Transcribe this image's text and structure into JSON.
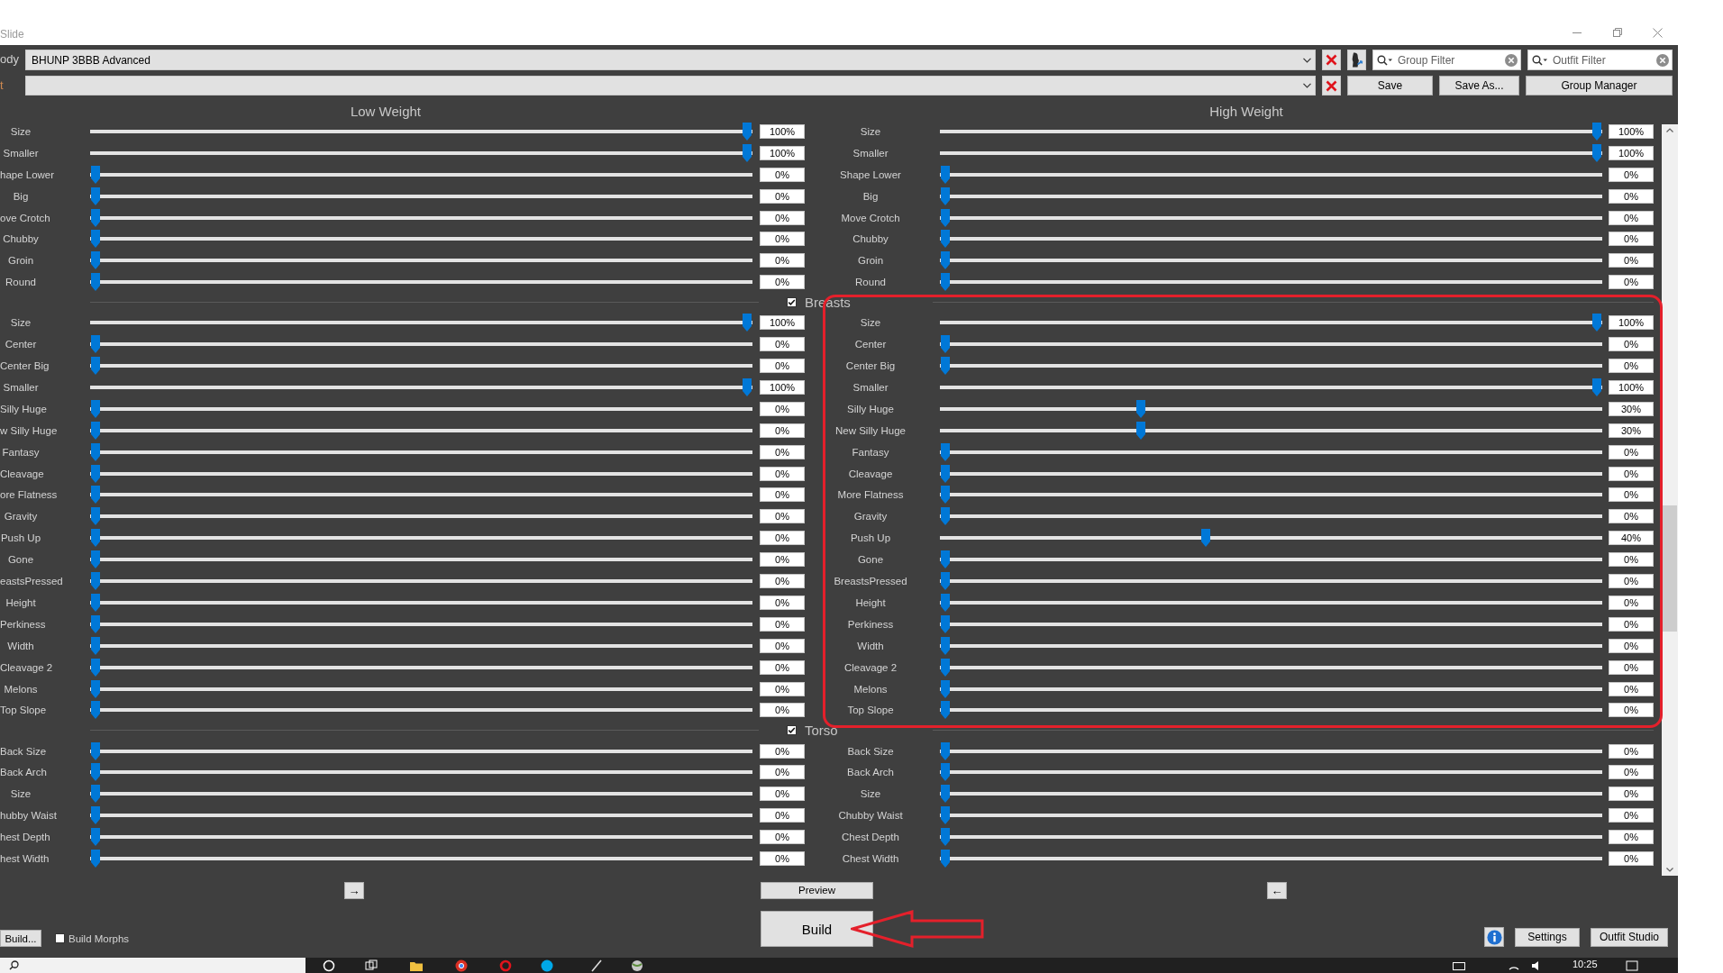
{
  "window": {
    "title": "Slide"
  },
  "selectors": [
    {
      "label": "ody",
      "color": "#cfcfcf",
      "value": "BHUNP 3BBB Advanced"
    },
    {
      "label": "t",
      "color": "#d08a50"
    }
  ],
  "filters": [
    {
      "placeholder": "Group Filter"
    },
    {
      "placeholder": "Outfit Filter"
    }
  ],
  "toolbar_buttons": [
    "Save",
    "Save As...",
    "Group Manager"
  ],
  "columns": [
    "Low Weight",
    "High Weight"
  ],
  "groups": [
    {
      "sliders": [
        {
          "low": {
            "label": "Size",
            "level": 1,
            "reading": "100%"
          },
          "high": {
            "label": "Size",
            "level": 1,
            "reading": "100%"
          }
        },
        {
          "low": {
            "label": "Smaller",
            "level": 1,
            "reading": "100%"
          },
          "high": {
            "label": "Smaller",
            "level": 1,
            "reading": "100%"
          }
        },
        {
          "low": {
            "label": "hape Lower",
            "level": 0,
            "reading": "0%"
          },
          "high": {
            "label": "Shape Lower",
            "level": 0,
            "reading": "0%"
          }
        },
        {
          "low": {
            "label": "Big",
            "level": 0,
            "reading": "0%"
          },
          "high": {
            "label": "Big",
            "level": 0,
            "reading": "0%"
          }
        },
        {
          "low": {
            "label": "ove Crotch",
            "level": 0,
            "reading": "0%"
          },
          "high": {
            "label": "Move Crotch",
            "level": 0,
            "reading": "0%"
          }
        },
        {
          "low": {
            "label": "Chubby",
            "level": 0,
            "reading": "0%"
          },
          "high": {
            "label": "Chubby",
            "level": 0,
            "reading": "0%"
          }
        },
        {
          "low": {
            "label": "Groin",
            "level": 0,
            "reading": "0%"
          },
          "high": {
            "label": "Groin",
            "level": 0,
            "reading": "0%"
          }
        },
        {
          "low": {
            "label": "Round",
            "level": 0,
            "reading": "0%"
          },
          "high": {
            "label": "Round",
            "level": 0,
            "reading": "0%"
          }
        }
      ]
    },
    {
      "title": "Breasts",
      "checked": true,
      "sliders": [
        {
          "low": {
            "label": "Size",
            "level": 1,
            "reading": "100%"
          },
          "high": {
            "label": "Size",
            "level": 1,
            "reading": "100%"
          }
        },
        {
          "low": {
            "label": "Center",
            "level": 0,
            "reading": "0%"
          },
          "high": {
            "label": "Center",
            "level": 0,
            "reading": "0%"
          }
        },
        {
          "low": {
            "label": "Center Big",
            "level": 0,
            "reading": "0%"
          },
          "high": {
            "label": "Center Big",
            "level": 0,
            "reading": "0%"
          }
        },
        {
          "low": {
            "label": "Smaller",
            "level": 1,
            "reading": "100%"
          },
          "high": {
            "label": "Smaller",
            "level": 1,
            "reading": "100%"
          }
        },
        {
          "low": {
            "label": "Silly Huge",
            "level": 0,
            "reading": "0%"
          },
          "high": {
            "label": "Silly Huge",
            "level": 0.3,
            "reading": "30%"
          }
        },
        {
          "low": {
            "label": "w Silly Huge",
            "level": 0,
            "reading": "0%"
          },
          "high": {
            "label": "New Silly Huge",
            "level": 0.3,
            "reading": "30%"
          }
        },
        {
          "low": {
            "label": "Fantasy",
            "level": 0,
            "reading": "0%"
          },
          "high": {
            "label": "Fantasy",
            "level": 0,
            "reading": "0%"
          }
        },
        {
          "low": {
            "label": "Cleavage",
            "level": 0,
            "reading": "0%"
          },
          "high": {
            "label": "Cleavage",
            "level": 0,
            "reading": "0%"
          }
        },
        {
          "low": {
            "label": "ore Flatness",
            "level": 0,
            "reading": "0%"
          },
          "high": {
            "label": "More Flatness",
            "level": 0,
            "reading": "0%"
          }
        },
        {
          "low": {
            "label": "Gravity",
            "level": 0,
            "reading": "0%"
          },
          "high": {
            "label": "Gravity",
            "level": 0,
            "reading": "0%"
          }
        },
        {
          "low": {
            "label": "Push Up",
            "level": 0,
            "reading": "0%"
          },
          "high": {
            "label": "Push Up",
            "level": 0.4,
            "reading": "40%"
          }
        },
        {
          "low": {
            "label": "Gone",
            "level": 0,
            "reading": "0%"
          },
          "high": {
            "label": "Gone",
            "level": 0,
            "reading": "0%"
          }
        },
        {
          "low": {
            "label": "eastsPressed",
            "level": 0,
            "reading": "0%"
          },
          "high": {
            "label": "BreastsPressed",
            "level": 0,
            "reading": "0%"
          }
        },
        {
          "low": {
            "label": "Height",
            "level": 0,
            "reading": "0%"
          },
          "high": {
            "label": "Height",
            "level": 0,
            "reading": "0%"
          }
        },
        {
          "low": {
            "label": "Perkiness",
            "level": 0,
            "reading": "0%"
          },
          "high": {
            "label": "Perkiness",
            "level": 0,
            "reading": "0%"
          }
        },
        {
          "low": {
            "label": "Width",
            "level": 0,
            "reading": "0%"
          },
          "high": {
            "label": "Width",
            "level": 0,
            "reading": "0%"
          }
        },
        {
          "low": {
            "label": "Cleavage 2",
            "level": 0,
            "reading": "0%"
          },
          "high": {
            "label": "Cleavage 2",
            "level": 0,
            "reading": "0%"
          }
        },
        {
          "low": {
            "label": "Melons",
            "level": 0,
            "reading": "0%"
          },
          "high": {
            "label": "Melons",
            "level": 0,
            "reading": "0%"
          }
        },
        {
          "low": {
            "label": "Top Slope",
            "level": 0,
            "reading": "0%"
          },
          "high": {
            "label": "Top Slope",
            "level": 0,
            "reading": "0%"
          }
        }
      ]
    },
    {
      "title": "Torso",
      "checked": true,
      "sliders": [
        {
          "low": {
            "label": "Back Size",
            "level": 0,
            "reading": "0%"
          },
          "high": {
            "label": "Back Size",
            "level": 0,
            "reading": "0%"
          }
        },
        {
          "low": {
            "label": "Back Arch",
            "level": 0,
            "reading": "0%"
          },
          "high": {
            "label": "Back Arch",
            "level": 0,
            "reading": "0%"
          }
        },
        {
          "low": {
            "label": "Size",
            "level": 0,
            "reading": "0%"
          },
          "high": {
            "label": "Size",
            "level": 0,
            "reading": "0%"
          }
        },
        {
          "low": {
            "label": "hubby Waist",
            "level": 0,
            "reading": "0%"
          },
          "high": {
            "label": "Chubby Waist",
            "level": 0,
            "reading": "0%"
          }
        },
        {
          "low": {
            "label": "hest Depth",
            "level": 0,
            "reading": "0%"
          },
          "high": {
            "label": "Chest Depth",
            "level": 0,
            "reading": "0%"
          }
        },
        {
          "low": {
            "label": "hest Width",
            "level": 0,
            "reading": "0%"
          },
          "high": {
            "label": "Chest Width",
            "level": 0,
            "reading": "0%"
          }
        }
      ]
    }
  ],
  "bottom": {
    "low_button": "→",
    "preview": "Preview",
    "high_button": "←",
    "build": "Build",
    "batch_build": "Build...",
    "build_morphs": {
      "label": "Build Morphs",
      "checked": false
    },
    "buttons": [
      "Settings",
      "Outfit Studio"
    ]
  },
  "taskbar": {
    "clock": "10:25"
  }
}
